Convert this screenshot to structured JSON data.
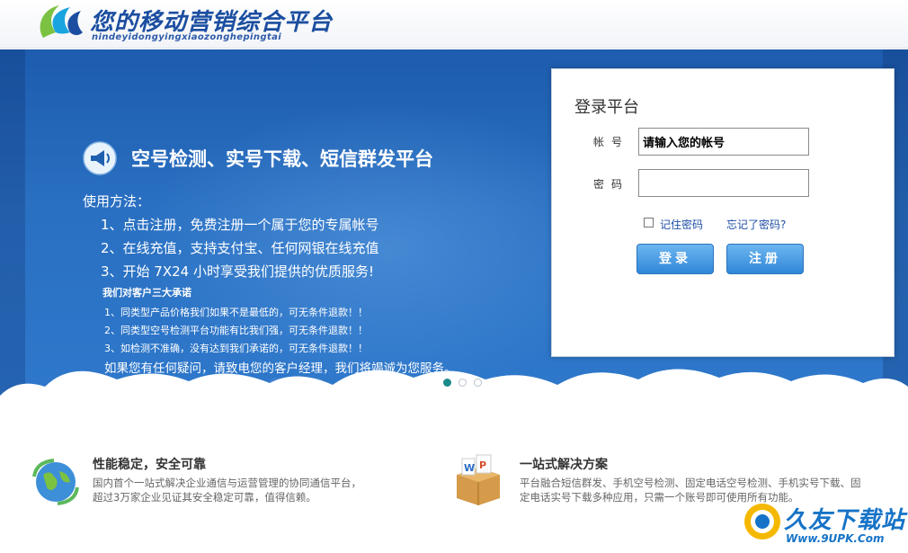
{
  "header": {
    "title": "您的移动营销综合平台",
    "subtitle": "nindeyidongyingxiaozonghepingtai"
  },
  "banner": {
    "headline": "空号检测、实号下载、短信群发平台",
    "usage_title": "使用方法：",
    "steps": [
      "1、点击注册，免费注册一个属于您的专属帐号",
      "2、在线充值，支持支付宝、任何网银在线充值",
      "3、开始 7X24 小时享受我们提供的优质服务!"
    ],
    "promise_title": "我们对客户三大承诺",
    "promises": [
      "1、同类型产品价格我们如果不是最低的，可无条件退款！！",
      "2、同类型空号检测平台功能有比我们强，可无条件退款！！",
      "3、如检测不准确，没有达到我们承诺的，可无条件退款！！"
    ],
    "contact": "如果您有任何疑问，请致电您的客户经理，我们将竭诚为您服务。",
    "carousel": {
      "active_index": 0,
      "count": 3
    }
  },
  "login": {
    "title": "登录平台",
    "account_label": "帐号",
    "account_value": "请输入您的帐号",
    "password_label": "密码",
    "password_value": "",
    "remember_label": "记住密码",
    "forgot_label": "忘记了密码?",
    "login_button": "登录",
    "register_button": "注册"
  },
  "features": [
    {
      "icon": "globe-arrows-icon",
      "title": "性能稳定，安全可靠",
      "desc_line1": "国内首个一站式解决企业通信与运营管理的协同通信平台，",
      "desc_line2": "超过3万家企业见证其安全稳定可靠，值得信赖。"
    },
    {
      "icon": "office-box-icon",
      "title": "一站式解决方案",
      "desc_line1": "平台融合短信群发、手机空号检测、固定电话空号检测、手机实号下载、固",
      "desc_line2": "定电话实号下载多种应用，只需一个账号即可使用所有功能。"
    }
  ],
  "watermark": {
    "text": "久友下载站",
    "url": "Www.9UPK.Com"
  },
  "colors": {
    "banner_blue": "#2a70c2",
    "brand_blue": "#1b4ea0",
    "button_blue": "#2f87d8",
    "link_blue": "#1e4ea6",
    "dot_active": "#1a8a8a"
  }
}
